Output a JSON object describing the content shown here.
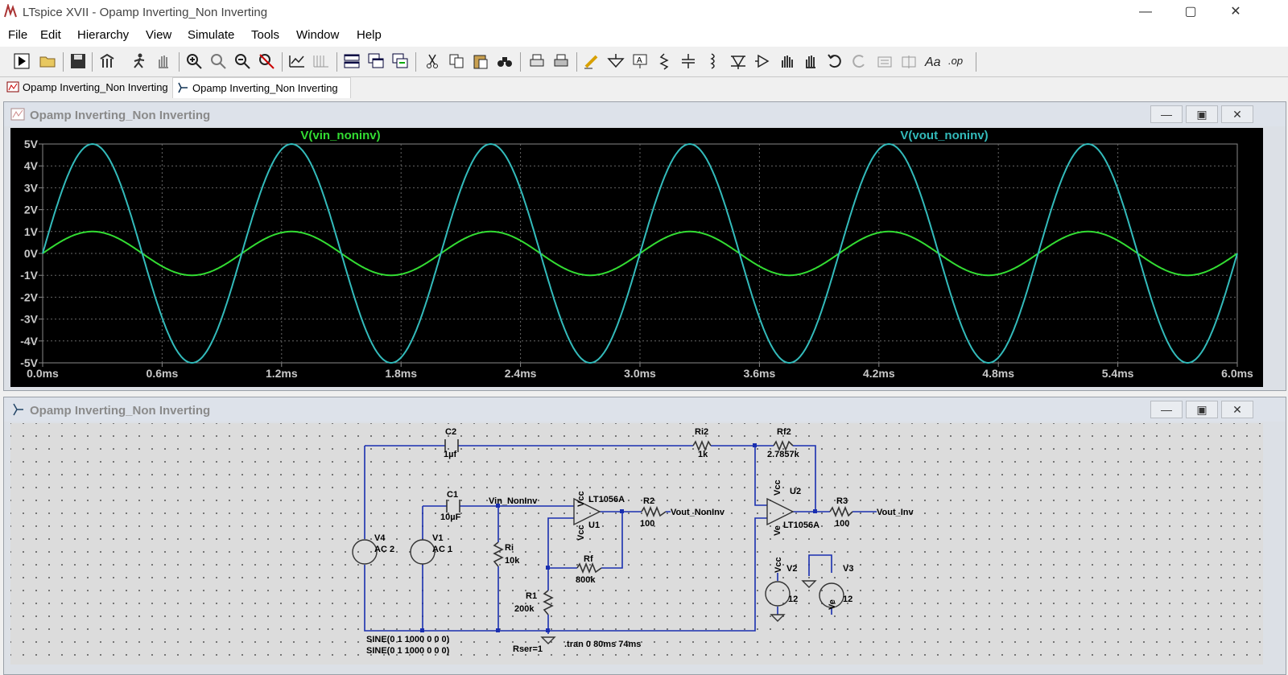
{
  "window": {
    "title": "LTspice XVII - Opamp Inverting_Non Inverting",
    "minimize": "—",
    "maximize": "▢",
    "close": "✕"
  },
  "menu": [
    "File",
    "Edit",
    "Hierarchy",
    "View",
    "Simulate",
    "Tools",
    "Window",
    "Help"
  ],
  "toolbar_icons": [
    "run-icon",
    "open-icon",
    "save-icon",
    "control-panel-icon",
    "halt-icon",
    "pan-icon",
    "zoom-in-icon",
    "zoom-rect-icon",
    "zoom-out-icon",
    "zoom-cancel-icon",
    "autorange-icon",
    "grid-icon",
    "tile-horizontal-icon",
    "cascade-icon",
    "tile-vertical-icon",
    "cut-icon",
    "copy-icon",
    "paste-icon",
    "find-icon",
    "print-setup-icon",
    "print-icon",
    "draw-wire-icon",
    "ground-icon",
    "label-net-icon",
    "resistor-icon",
    "capacitor-icon",
    "inductor-icon",
    "diode-icon",
    "component-icon",
    "move-icon",
    "drag-icon",
    "undo-icon",
    "redo-icon",
    "rotate-icon",
    "mirror-icon",
    "text-icon",
    "spice-directive-icon"
  ],
  "tabs": [
    {
      "label": "Opamp Inverting_Non Inverting",
      "kind": "waveform"
    },
    {
      "label": "Opamp Inverting_Non Inverting",
      "kind": "schematic"
    }
  ],
  "plot_window": {
    "title": "Opamp Inverting_Non Inverting"
  },
  "schematic_window": {
    "title": "Opamp Inverting_Non Inverting"
  },
  "chart_data": {
    "type": "line",
    "xlim": [
      0,
      6
    ],
    "ylim": [
      -5,
      5
    ],
    "x_unit": "ms",
    "x_ticks": [
      "0.0ms",
      "0.6ms",
      "1.2ms",
      "1.8ms",
      "2.4ms",
      "3.0ms",
      "3.6ms",
      "4.2ms",
      "4.8ms",
      "5.4ms",
      "6.0ms"
    ],
    "y_ticks": [
      "5V",
      "4V",
      "3V",
      "2V",
      "1V",
      "0V",
      "-1V",
      "-2V",
      "-3V",
      "-4V",
      "-5V"
    ],
    "grid": true,
    "series": [
      {
        "name": "V(vin_noninv)",
        "color": "#33dd33",
        "amplitude": 1,
        "frequency_khz": 1,
        "offset": 0
      },
      {
        "name": "V(vout_noninv)",
        "color": "#33bbbb",
        "amplitude": 5,
        "frequency_khz": 1,
        "offset": 0
      }
    ]
  },
  "schematic": {
    "labels": {
      "c2": "C2",
      "c2v": "1µf",
      "ri2": "Ri2",
      "ri2v": "1k",
      "rf2": "Rf2",
      "rf2v": "2.7857k",
      "c1": "C1",
      "c1v": "10µF",
      "vin": "Vin_NonInv",
      "u1": "U1",
      "u1m": "LT1056A",
      "r2": "R2",
      "r2v": "100",
      "vout_ni": "Vout_NonInv",
      "u2": "U2",
      "u2m": "LT1056A",
      "r3": "R3",
      "r3v": "100",
      "vout_inv": "Vout_Inv",
      "v4": "V4",
      "v4v": "AC 2",
      "v1": "V1",
      "v1v": "AC 1",
      "ri": "Ri",
      "riv": "10k",
      "rf": "Rf",
      "rfv": "800k",
      "r1": "R1",
      "r1v": "200k",
      "v2": "V2",
      "v2v": "12",
      "v3": "V3",
      "v3v": "12",
      "vcc": "Vcc",
      "ve": "Ve",
      "sine1": "SINE(0 1 1000 0 0 0)",
      "sine2": "SINE(0 1 1000 0 0 0)",
      "rser": "Rser=1",
      "tran": ".tran 0 80ms 74ms"
    }
  }
}
